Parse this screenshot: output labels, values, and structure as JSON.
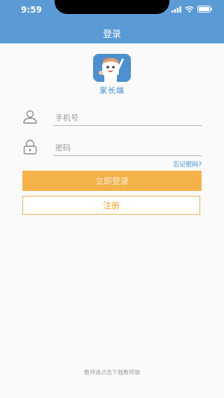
{
  "status_bar": {
    "time": "9:59"
  },
  "nav": {
    "title": "登录"
  },
  "app": {
    "name": "家长端",
    "icon": "cartoon-student-app-icon"
  },
  "form": {
    "phone": {
      "placeholder": "手机号",
      "value": "",
      "icon": "user-icon"
    },
    "password": {
      "placeholder": "密码",
      "value": "",
      "icon": "lock-icon"
    },
    "forgot_password_label": "忘记密码?",
    "login_label": "立即登录",
    "register_label": "注册"
  },
  "footer": {
    "text": "教师请点击下载教师端"
  },
  "colors": {
    "header_bg": "#5b9bd5",
    "accent_blue": "#3b8ed6",
    "login_orange": "#f3b24a",
    "register_border": "#f0b14b"
  }
}
